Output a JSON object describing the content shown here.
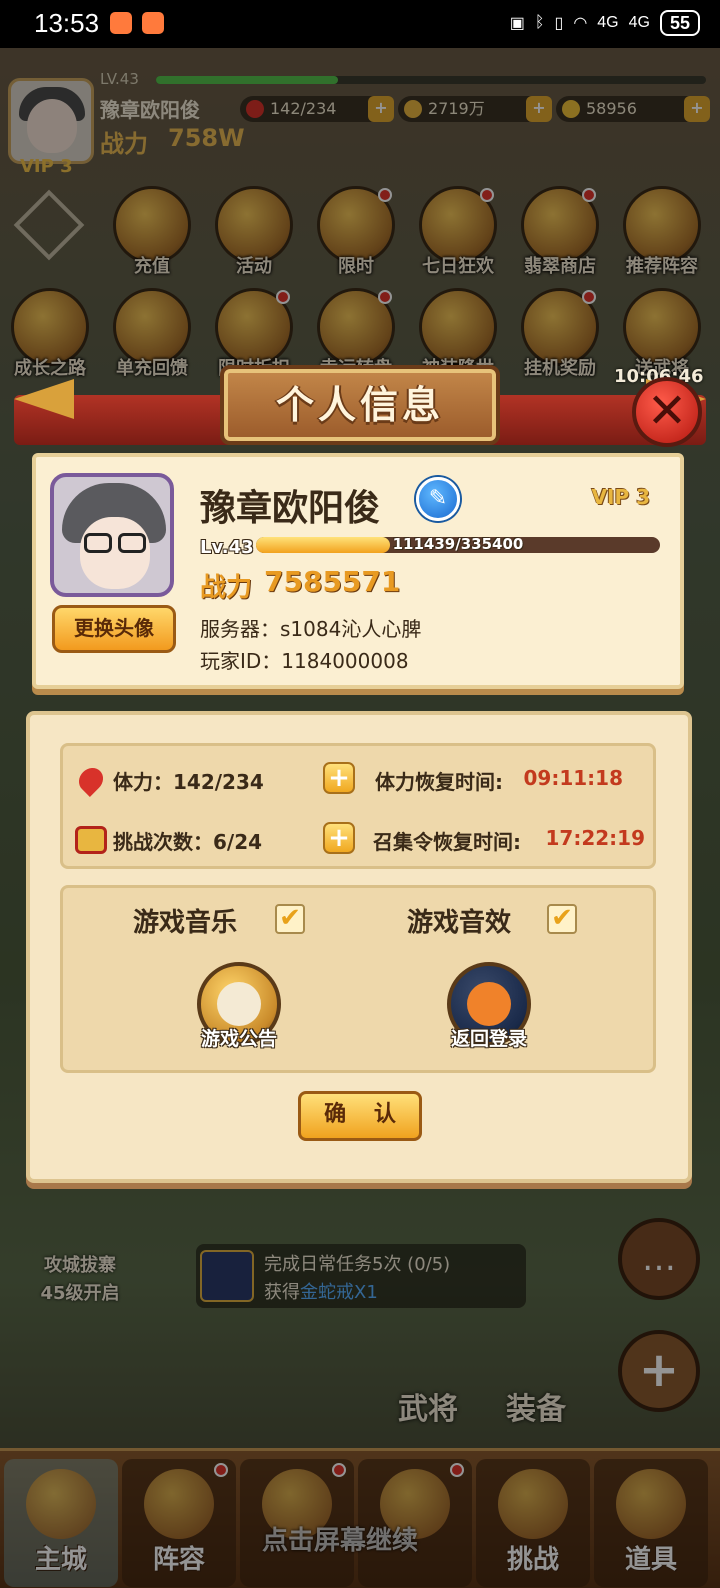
{
  "status_bar": {
    "time": "13:53",
    "battery": "55",
    "net1": "4G",
    "net2": "4G"
  },
  "top_bar": {
    "level": "LV.43",
    "name": "豫章欧阳俊",
    "power_label": "战力",
    "power": "758W",
    "vip": "VIP 3",
    "stamina": "142/234",
    "gold": "2719万",
    "gems": "58956"
  },
  "grid_icons": [
    {
      "label": "充值"
    },
    {
      "label": "活动"
    },
    {
      "label": "限时"
    },
    {
      "label": "七日狂欢"
    },
    {
      "label": "翡翠商店"
    },
    {
      "label": "推荐阵容"
    },
    {
      "label": "成长之路"
    },
    {
      "label": "单充回馈"
    },
    {
      "label": "限时折扣"
    },
    {
      "label": "幸运转盘"
    },
    {
      "label": "神装降世"
    },
    {
      "label": "挂机奖励"
    },
    {
      "label": "送武将"
    }
  ],
  "clock": "10:06:46",
  "modal": {
    "title": "个人信息",
    "close": "✕",
    "change_avatar": "更换头像",
    "player_name": "豫章欧阳俊",
    "vip": "VIP 3",
    "level": "Lv.43",
    "exp_text": "111439/335400",
    "exp_fraction": 0.332,
    "power_label": "战力",
    "power": "7585571",
    "server": "服务器：s1084沁人心脾",
    "player_id": "玩家ID：1184000008",
    "stamina_label": "体力：142/234",
    "stamina_recover_label": "体力恢复时间:",
    "stamina_recover_time": "09:11:18",
    "challenge_label": "挑战次数：6/24",
    "summon_recover_label": "召集令恢复时间:",
    "summon_recover_time": "17:22:19",
    "music_label": "游戏音乐",
    "sfx_label": "游戏音效",
    "music_on": true,
    "sfx_on": true,
    "announce_label": "游戏公告",
    "relogin_label": "返回登录",
    "confirm": "确 认"
  },
  "siege": {
    "line1": "攻城拔寨",
    "line2": "45级开启"
  },
  "quest": {
    "line1": "完成日常任务5次 (0/5)",
    "line2_prefix": "获得",
    "line2_reward": "金蛇戒X1"
  },
  "side": {
    "generals": "武将",
    "equip": "装备"
  },
  "bottom_nav": [
    {
      "label": "主城"
    },
    {
      "label": "阵容"
    },
    {
      "label": ""
    },
    {
      "label": ""
    },
    {
      "label": "挑战"
    },
    {
      "label": "道具"
    }
  ],
  "hint": "点击屏幕继续"
}
